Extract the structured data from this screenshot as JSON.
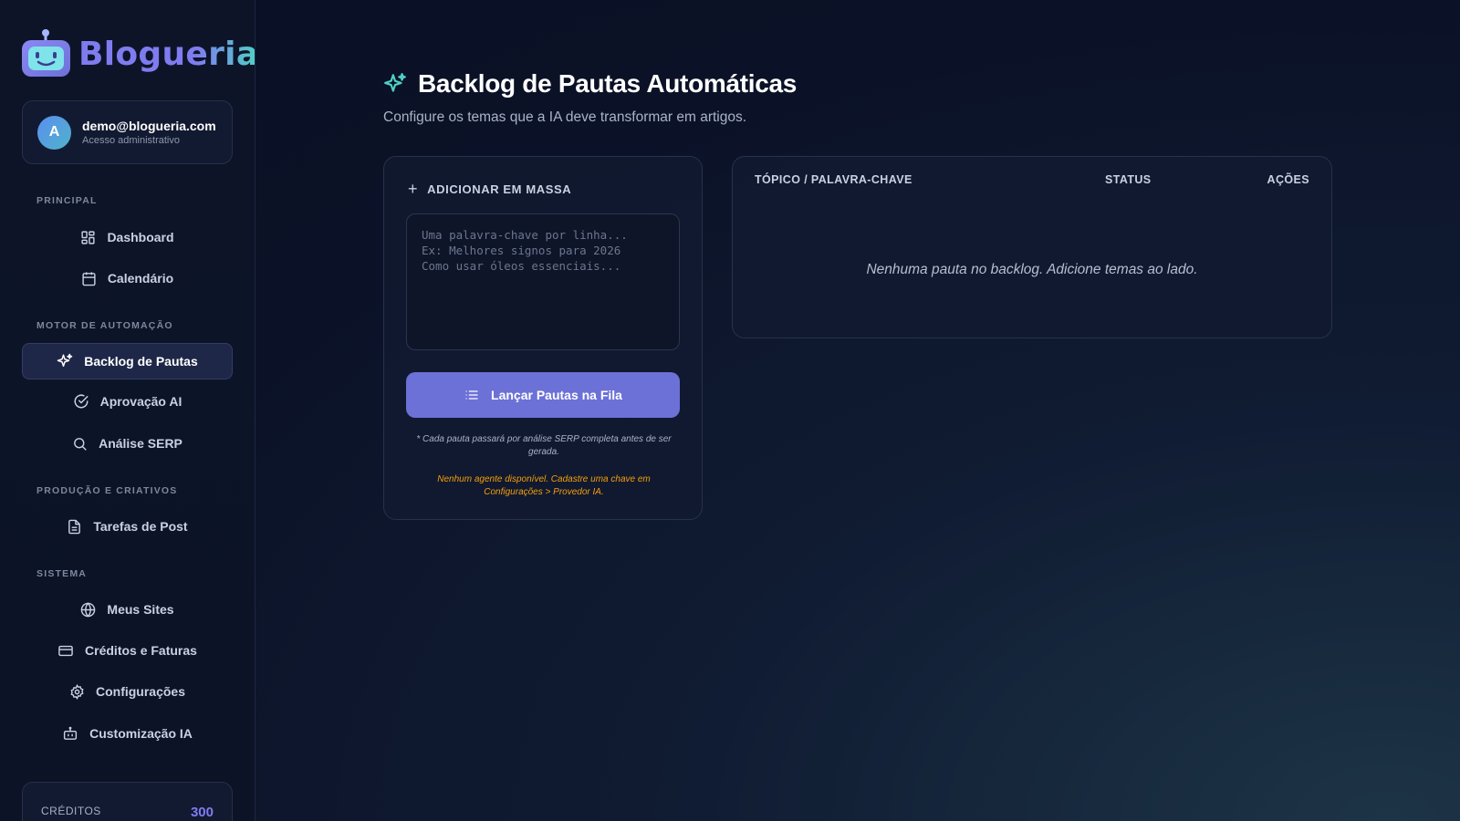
{
  "brand": {
    "name": "Blogueria"
  },
  "user": {
    "initial": "A",
    "email": "demo@blogueria.com",
    "role": "Acesso administrativo"
  },
  "sidebar": {
    "sections": [
      {
        "label": "PRINCIPAL",
        "items": [
          {
            "label": "Dashboard",
            "icon": "dashboard-icon"
          },
          {
            "label": "Calendário",
            "icon": "calendar-icon"
          }
        ]
      },
      {
        "label": "MOTOR DE AUTOMAÇÃO",
        "items": [
          {
            "label": "Backlog de Pautas",
            "icon": "sparkles-icon",
            "active": true
          },
          {
            "label": "Aprovação AI",
            "icon": "check-circle-icon"
          },
          {
            "label": "Análise SERP",
            "icon": "search-icon"
          }
        ]
      },
      {
        "label": "PRODUÇÃO E CRIATIVOS",
        "items": [
          {
            "label": "Tarefas de Post",
            "icon": "document-icon"
          }
        ]
      },
      {
        "label": "SISTEMA",
        "items": [
          {
            "label": "Meus Sites",
            "icon": "globe-icon"
          },
          {
            "label": "Créditos e Faturas",
            "icon": "credit-card-icon"
          },
          {
            "label": "Configurações",
            "icon": "gear-icon"
          },
          {
            "label": "Customização IA",
            "icon": "bot-icon"
          }
        ]
      }
    ],
    "credits": {
      "label": "CRÉDITOS",
      "value": "300"
    }
  },
  "main": {
    "title": "Backlog de Pautas Automáticas",
    "subtitle": "Configure os temas que a IA deve transformar em artigos.",
    "bulk": {
      "header": "ADICIONAR EM MASSA",
      "placeholder": "Uma palavra-chave por linha...\nEx: Melhores signos para 2026\nComo usar óleos essenciais...",
      "value": "",
      "button": "Lançar Pautas na Fila",
      "note_serp": "* Cada pauta passará por análise SERP completa antes de ser gerada.",
      "note_warning": "Nenhum agente disponível. Cadastre uma chave em Configurações > Provedor IA."
    },
    "table": {
      "columns": [
        "TÓPICO / PALAVRA-CHAVE",
        "STATUS",
        "AÇÕES"
      ],
      "rows": [],
      "empty_message": "Nenhuma pauta no backlog. Adicione temas ao lado."
    }
  },
  "colors": {
    "accent": "#6c71d7",
    "brand_teal": "#4fd1c5",
    "warning": "#f59e0b",
    "background": "#0b1227"
  }
}
